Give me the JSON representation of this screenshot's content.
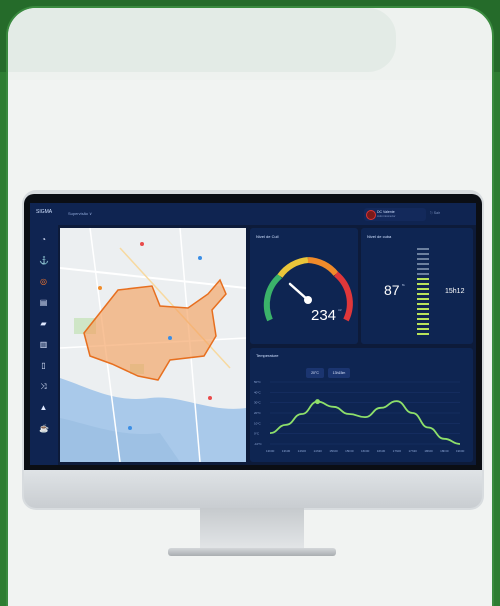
{
  "app": {
    "logo": "SIGMA",
    "nav": "Supervisão ∨",
    "user_name": "DC Valente",
    "user_role": "Administrador",
    "logout": "⎋ Sair"
  },
  "sidebar": {
    "items": [
      "gauge-icon",
      "anchor-icon",
      "target-icon",
      "layers-icon",
      "folder-icon",
      "chart-icon",
      "building-icon",
      "shuffle-icon",
      "warning-icon",
      "coffee-icon"
    ]
  },
  "panels": {
    "gauge": {
      "title": "Nivel de Cuil",
      "value": "234",
      "unit": "m³"
    },
    "level": {
      "title": "Nivel de cuba",
      "value": "87",
      "unit": "%",
      "time": "15h12"
    },
    "temperature": {
      "title": "Temperature",
      "tag_temp": "20°C",
      "tag_time": "13h15m"
    }
  },
  "chart_data": {
    "type": "line",
    "title": "Temperature",
    "x": [
      "13h00",
      "13h30",
      "14h00",
      "14h30",
      "15h00",
      "15h30",
      "16h00",
      "16h30",
      "17h00",
      "17h30",
      "18h00",
      "18h30",
      "19h00"
    ],
    "y_ticks": [
      "50°C",
      "40°C",
      "30°C",
      "20°C",
      "10°C",
      "0°C",
      "-10°C"
    ],
    "series": [
      {
        "values": [
          0.5,
          8.5,
          19,
          31,
          26,
          19,
          16,
          25,
          31.5,
          20,
          6,
          -5,
          -10
        ]
      }
    ],
    "ylim": [
      -10,
      50
    ],
    "grid": true,
    "colors": {
      "line": "#8ee06a"
    }
  }
}
